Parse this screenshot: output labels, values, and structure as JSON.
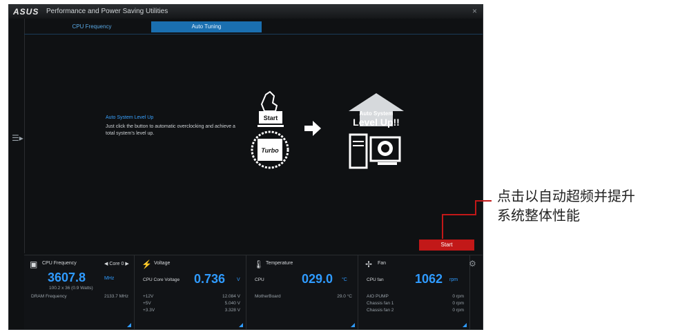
{
  "app": {
    "logo": "ASUS",
    "title": "Performance and Power Saving Utilities",
    "close": "×"
  },
  "tabs": [
    {
      "label": "CPU Frequency"
    },
    {
      "label": "Auto Tuning"
    }
  ],
  "main": {
    "desc_title": "Auto System Level Up",
    "desc_text": "Just click the button to automatic overclocking and achieve a total system's level up.",
    "start_graphic_label": "Start",
    "turbo_label": "Turbo",
    "levelup_small": "Auto System",
    "levelup_big": "Level Up!!",
    "start_button": "Start"
  },
  "panels": {
    "cpu": {
      "title": "CPU Frequency",
      "core_label": "Core 0",
      "value": "3607.8",
      "unit": "MHz",
      "sub": "100.2 x 36 (0.9 Watts)",
      "row_label": "DRAM Frequency",
      "row_value": "2133.7 MHz"
    },
    "voltage": {
      "title": "Voltage",
      "main_label": "CPU Core Voltage",
      "main_value": "0.736",
      "main_unit": "V",
      "rows": [
        {
          "label": "+12V",
          "value": "12.084 V"
        },
        {
          "label": "+5V",
          "value": "5.040 V"
        },
        {
          "label": "+3.3V",
          "value": "3.328 V"
        }
      ]
    },
    "temperature": {
      "title": "Temperature",
      "main_label": "CPU",
      "main_value": "029.0",
      "main_unit": "°C",
      "rows": [
        {
          "label": "MotherBoard",
          "value": "29.0 °C"
        }
      ]
    },
    "fan": {
      "title": "Fan",
      "main_label": "CPU fan",
      "main_value": "1062",
      "main_unit": "rpm",
      "rows": [
        {
          "label": "AIO PUMP",
          "value": "0 rpm"
        },
        {
          "label": "Chassis fan 1",
          "value": "0 rpm"
        },
        {
          "label": "Chassis fan 2",
          "value": "0 rpm"
        }
      ]
    }
  },
  "callout": {
    "line1": "点击以自动超频并提升",
    "line2": "系统整体性能"
  },
  "colors": {
    "accent": "#2f9bff",
    "start_red": "#c21818",
    "bg": "#0f1113"
  }
}
